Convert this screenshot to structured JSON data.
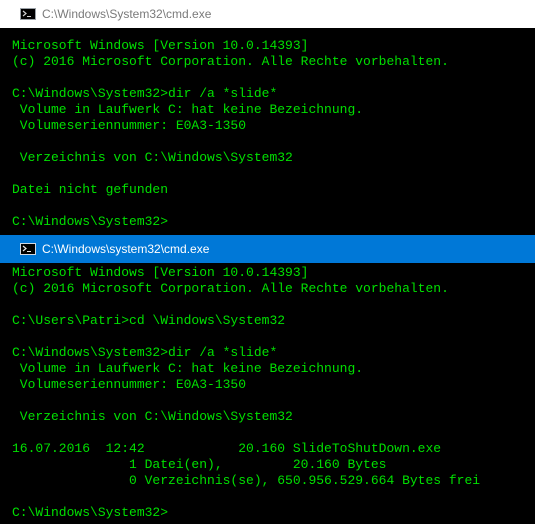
{
  "window1": {
    "title": "C:\\Windows\\System32\\cmd.exe",
    "lines": [
      "Microsoft Windows [Version 10.0.14393]",
      "(c) 2016 Microsoft Corporation. Alle Rechte vorbehalten.",
      "",
      "C:\\Windows\\System32>dir /a *slide*",
      " Volume in Laufwerk C: hat keine Bezeichnung.",
      " Volumeseriennummer: E0A3-1350",
      "",
      " Verzeichnis von C:\\Windows\\System32",
      "",
      "Datei nicht gefunden",
      "",
      "C:\\Windows\\System32>"
    ]
  },
  "window2": {
    "title": "C:\\Windows\\system32\\cmd.exe",
    "lines": [
      "Microsoft Windows [Version 10.0.14393]",
      "(c) 2016 Microsoft Corporation. Alle Rechte vorbehalten.",
      "",
      "C:\\Users\\Patri>cd \\Windows\\System32",
      "",
      "C:\\Windows\\System32>dir /a *slide*",
      " Volume in Laufwerk C: hat keine Bezeichnung.",
      " Volumeseriennummer: E0A3-1350",
      "",
      " Verzeichnis von C:\\Windows\\System32",
      "",
      "16.07.2016  12:42            20.160 SlideToShutDown.exe",
      "               1 Datei(en),         20.160 Bytes",
      "               0 Verzeichnis(se), 650.956.529.664 Bytes frei",
      "",
      "C:\\Windows\\System32>"
    ]
  },
  "colors": {
    "console_text": "#00e000",
    "console_background": "#000000",
    "active_titlebar": "#0078d7",
    "inactive_titlebar": "#ffffff"
  },
  "icons": {
    "titlebar": "cmd-prompt-icon"
  }
}
